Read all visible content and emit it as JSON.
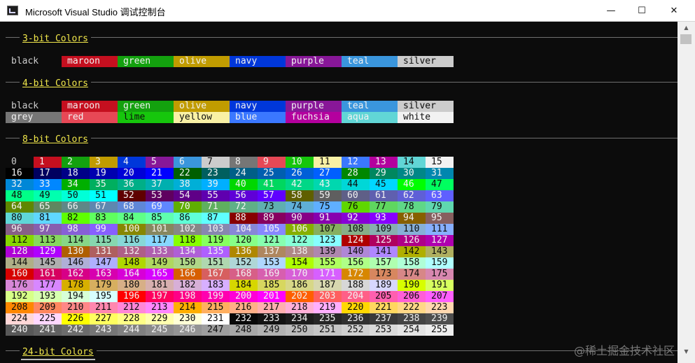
{
  "window": {
    "title": "Microsoft Visual Studio 调试控制台",
    "icon": "console-app-icon",
    "controls": {
      "minimize": "—",
      "maximize": "☐",
      "close": "✕"
    }
  },
  "sections": {
    "bit3": {
      "heading": "3-bit Colors"
    },
    "bit4": {
      "heading": "4-bit Colors"
    },
    "bit8": {
      "heading": "8-bit Colors"
    },
    "bit24": {
      "heading": "24-bit Colors"
    }
  },
  "color_names_normal": [
    "black",
    "maroon",
    "green",
    "olive",
    "navy",
    "purple",
    "teal",
    "silver"
  ],
  "color_names_bright": [
    "grey",
    "red",
    "lime",
    "yellow",
    "blue",
    "fuchsia",
    "aqua",
    "white"
  ],
  "palette": {
    "normal": [
      "#0c0c0c",
      "#c50f1f",
      "#13a10e",
      "#c19c00",
      "#0037da",
      "#881798",
      "#3a96dd",
      "#cccccc"
    ],
    "bright": [
      "#767676",
      "#e74856",
      "#16c60c",
      "#f9f1a5",
      "#3b78ff",
      "#b4009e",
      "#61d6d6",
      "#f2f2f2"
    ],
    "cube_levels": [
      0,
      95,
      135,
      175,
      215,
      255
    ]
  },
  "eight_bit_indices": "0-255",
  "scrollbar": {
    "up_icon": "▲",
    "down_icon": "▼"
  },
  "watermark": "@稀土掘金技术社区"
}
